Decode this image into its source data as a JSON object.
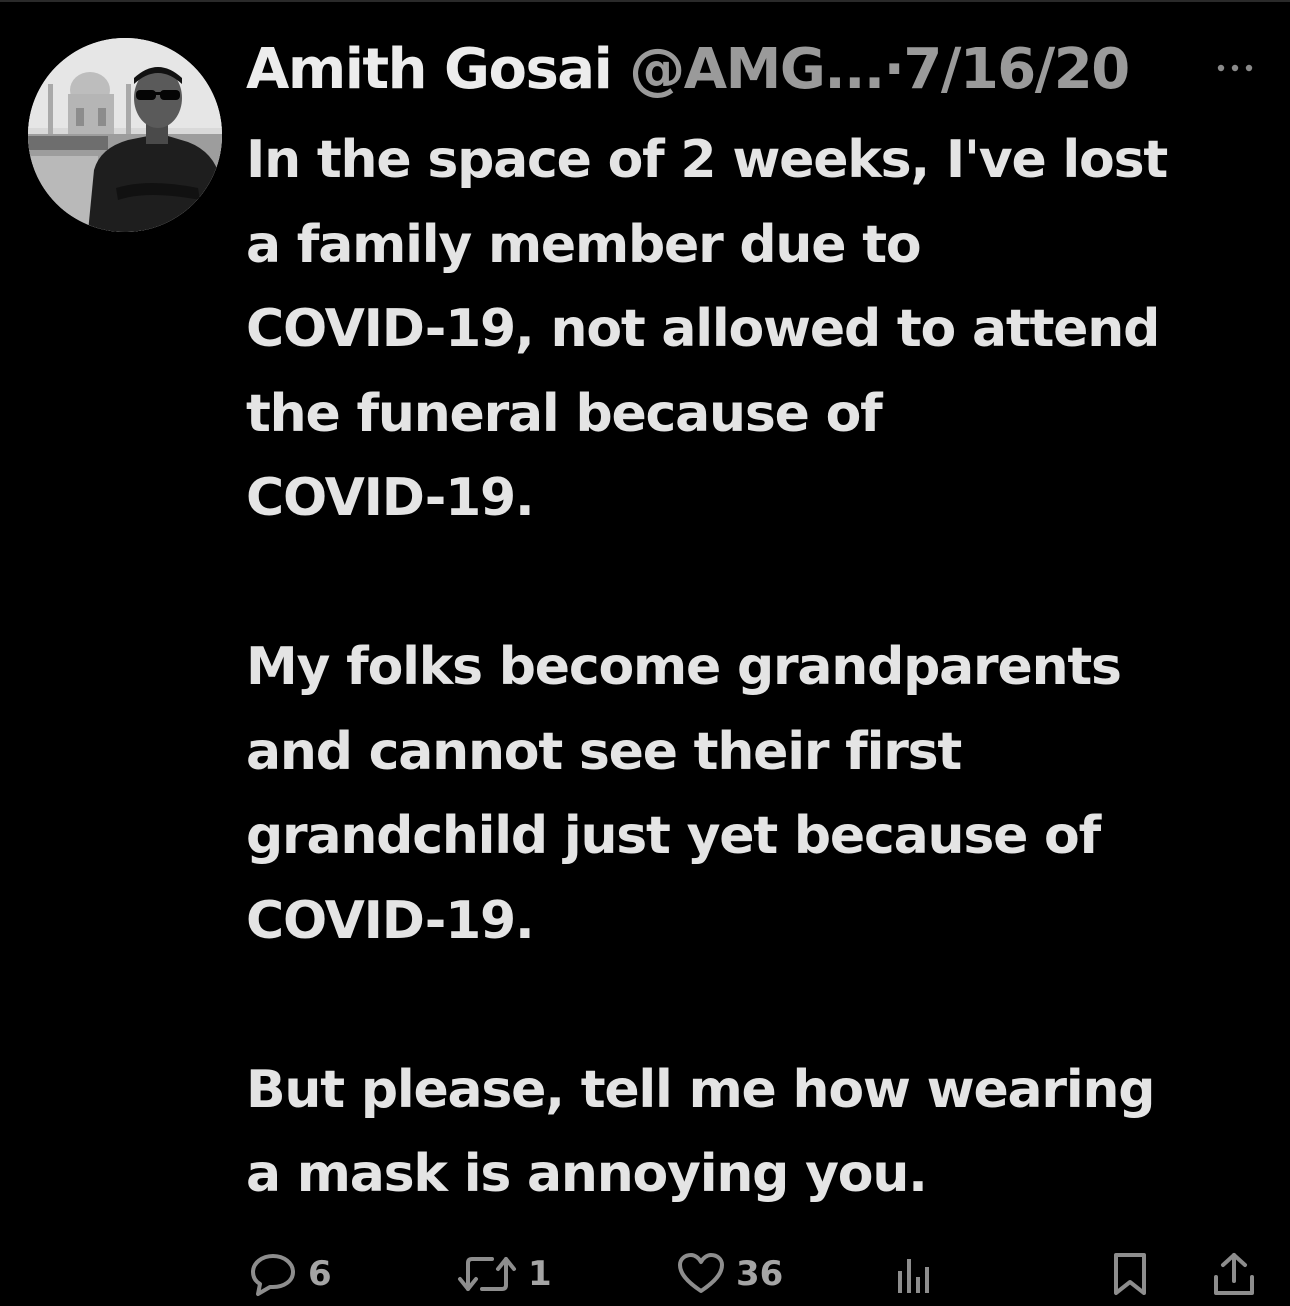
{
  "tweet": {
    "author_name": "Amith Gosai",
    "handle": "@AMG...",
    "separator": "·",
    "date": "7/16/20",
    "more_label": "···",
    "paragraphs": [
      [
        "In the space of 2 weeks, I've lost",
        "a family member due to",
        "COVID-19, not allowed to attend",
        "the funeral because of",
        "COVID-19."
      ],
      [
        "My folks become grandparents",
        "and cannot see their first",
        "grandchild just yet because of",
        "COVID-19."
      ],
      [
        "But please, tell me how wearing",
        "a mask is annoying you."
      ]
    ]
  },
  "actions": {
    "reply_count": "6",
    "retweet_count": "1",
    "like_count": "36",
    "icons": [
      "reply-icon",
      "retweet-icon",
      "like-icon",
      "views-icon",
      "bookmark-icon",
      "share-icon"
    ]
  },
  "colors": {
    "background": "#000000",
    "text": "#e4e4e4",
    "muted": "#9a9a9a"
  }
}
